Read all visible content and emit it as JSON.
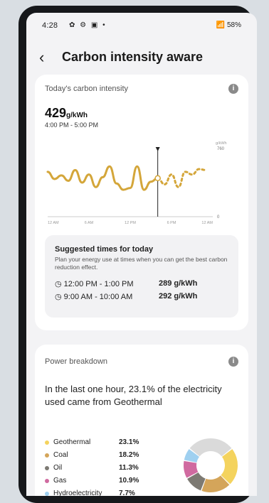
{
  "status": {
    "time": "4:28",
    "left_icons": "✿ ⚙ ▣ •",
    "right": "📶 58%"
  },
  "appbar": {
    "back_icon": "chevron-left-icon",
    "title": "Carbon intensity aware"
  },
  "intensity": {
    "heading": "Today's carbon intensity",
    "value": "429",
    "unit": "g/kWh",
    "range": "4:00 PM - 5:00 PM",
    "suggest_title": "Suggested times for today",
    "suggest_desc": "Plan your energy use at times when you can get the best carbon reduction effect.",
    "suggestions": [
      {
        "time": "12:00 PM - 1:00 PM",
        "value": "289 g/kWh"
      },
      {
        "time": "9:00 AM - 10:00 AM",
        "value": "292 g/kWh"
      }
    ]
  },
  "chart_data": {
    "type": "line",
    "ylabel": "g/kWh",
    "ylim": [
      0,
      760
    ],
    "y_ticks": [
      "760",
      "0"
    ],
    "x_ticks": [
      "12 AM",
      "6 AM",
      "12 PM",
      "6 PM",
      "12 AM"
    ],
    "current_hour": 16,
    "series": [
      {
        "style": "solid",
        "x": [
          0,
          1,
          2,
          3,
          4,
          5,
          6,
          7,
          8,
          9,
          10,
          11,
          12,
          13,
          14,
          15,
          16
        ],
        "values": [
          500,
          420,
          460,
          400,
          520,
          380,
          470,
          330,
          440,
          560,
          370,
          300,
          320,
          560,
          300,
          390,
          429
        ]
      },
      {
        "style": "dotted",
        "x": [
          16,
          17,
          18,
          19,
          20,
          21,
          22,
          23
        ],
        "values": [
          429,
          360,
          470,
          330,
          500,
          470,
          530,
          520
        ]
      }
    ],
    "colors": {
      "line": "#d4a63a",
      "marker": "#222222",
      "axis": "#999999"
    }
  },
  "power": {
    "heading": "Power breakdown",
    "summary": "In the last one hour, 23.1% of the electricity used came from Geothermal",
    "items": [
      {
        "label": "Geothermal",
        "pct": "23.1%",
        "value": 23.1,
        "color": "#f4d35e"
      },
      {
        "label": "Coal",
        "pct": "18.2%",
        "value": 18.2,
        "color": "#d4a55a"
      },
      {
        "label": "Oil",
        "pct": "11.3%",
        "value": 11.3,
        "color": "#7d7a73"
      },
      {
        "label": "Gas",
        "pct": "10.9%",
        "value": 10.9,
        "color": "#d06aa0"
      },
      {
        "label": "Hydroelectricity",
        "pct": "7.7%",
        "value": 7.7,
        "color": "#9fd0f0"
      }
    ],
    "other_color": "#dadada"
  }
}
